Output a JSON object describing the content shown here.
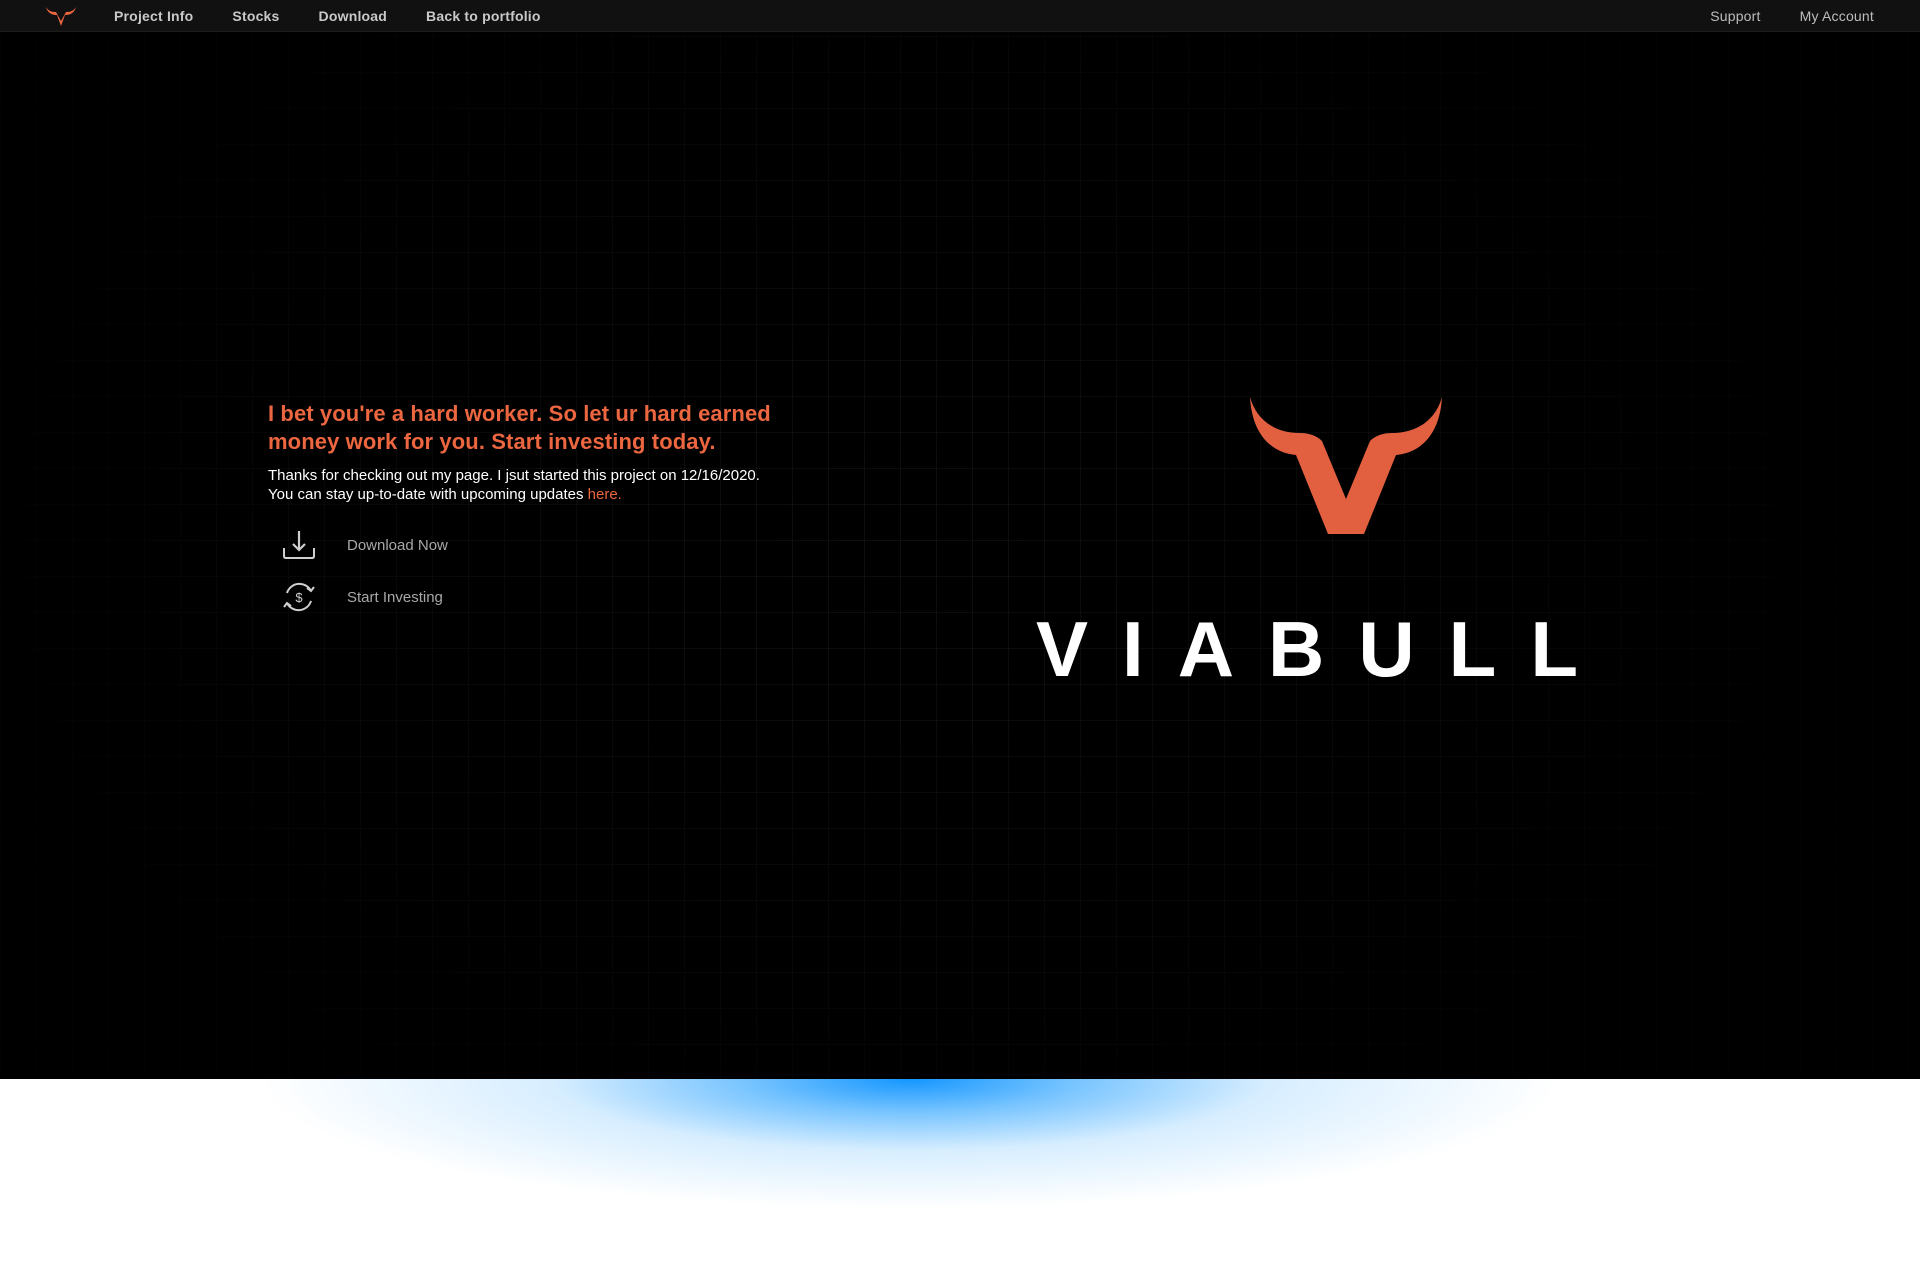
{
  "nav": {
    "left": [
      "Project Info",
      "Stocks",
      "Download",
      "Back to portfolio"
    ],
    "right": [
      "Support",
      "My Account"
    ]
  },
  "hero": {
    "headline": "I bet you're a hard worker. So let ur hard earned money work for you. Start investing today.",
    "subtext": "Thanks for checking out my page. I jsut started this project on 12/16/2020. You can stay up-to-date with upcoming updates ",
    "subtext_link": "here.",
    "actions": [
      {
        "label": "Download Now",
        "icon": "download-icon"
      },
      {
        "label": "Start Investing",
        "icon": "dollar-refresh-icon"
      }
    ]
  },
  "brand": {
    "wordmark": "VIABULL",
    "accent_color": "#ec6640",
    "logo_icon": "bull-horns-logo-icon"
  },
  "colors": {
    "background": "#000000",
    "topbar": "#111111",
    "glow": "#1496ff"
  }
}
